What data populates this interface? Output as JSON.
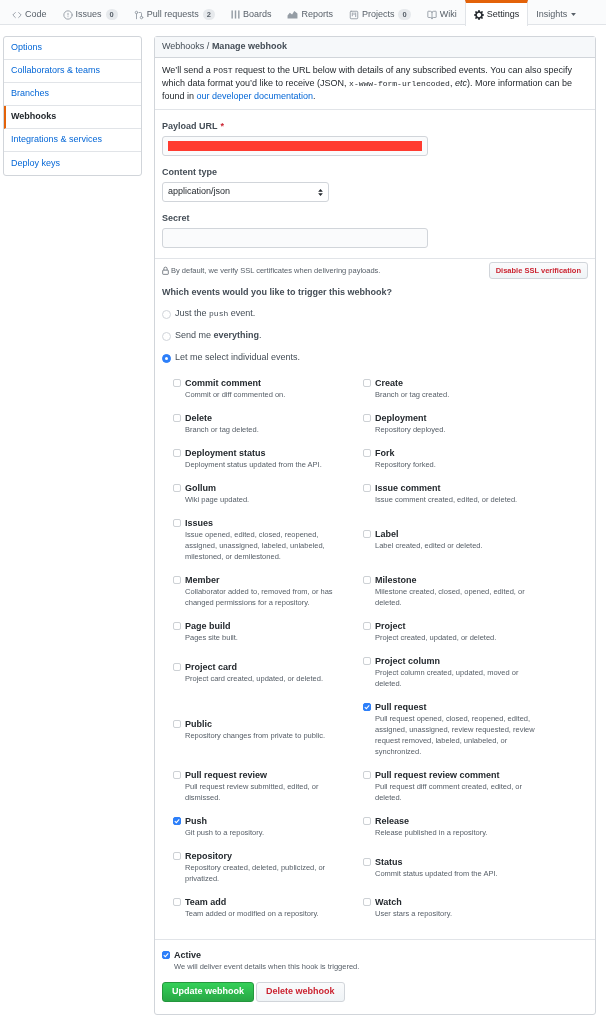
{
  "tabs": [
    {
      "label": "Code",
      "selected": false
    },
    {
      "label": "Issues",
      "count": "0",
      "selected": false
    },
    {
      "label": "Pull requests",
      "count": "2",
      "selected": false
    },
    {
      "label": "Boards",
      "selected": false
    },
    {
      "label": "Reports",
      "selected": false
    },
    {
      "label": "Projects",
      "count": "0",
      "selected": false
    },
    {
      "label": "Wiki",
      "selected": false
    },
    {
      "label": "Settings",
      "selected": true
    },
    {
      "label": "Insights",
      "selected": false,
      "dropdown": true
    }
  ],
  "sidebar": {
    "items": [
      {
        "label": "Options",
        "selected": false
      },
      {
        "label": "Collaborators & teams",
        "selected": false
      },
      {
        "label": "Branches",
        "selected": false
      },
      {
        "label": "Webhooks",
        "selected": true
      },
      {
        "label": "Integrations & services",
        "selected": false
      },
      {
        "label": "Deploy keys",
        "selected": false
      }
    ]
  },
  "panel": {
    "title": "Webhooks / **Manage webhook**",
    "intro": [
      {
        "kind": "text",
        "text": "We’ll send a "
      },
      {
        "kind": "code",
        "text": "POST"
      },
      {
        "kind": "text",
        "text": " request to the URL below with details of any subscribed events. You can also specify which data format you’d like to receive (JSON, "
      },
      {
        "kind": "code",
        "text": "x-www-form-urlencoded"
      },
      {
        "kind": "text",
        "text": ", *etc*). More information can be found in "
      },
      {
        "kind": "link",
        "text": "our developer documentation"
      },
      {
        "kind": "text",
        "text": "."
      }
    ]
  },
  "form": {
    "payload_url": {
      "label": "Payload URL",
      "required_mark": "*",
      "redacted": true
    },
    "content_type": {
      "label": "Content type",
      "value": "application/json"
    },
    "secret": {
      "label": "Secret"
    }
  },
  "ssl": {
    "note": "By default, we verify SSL certificates when delivering payloads.",
    "button": "Disable SSL verification"
  },
  "events": {
    "question": "Which events would you like to trigger this webhook?",
    "options": [
      {
        "parts": [
          {
            "kind": "text",
            "text": "Just the "
          },
          {
            "kind": "code",
            "text": "push"
          },
          {
            "kind": "text",
            "text": " event."
          }
        ],
        "selected": false
      },
      {
        "parts": [
          {
            "kind": "text",
            "text": "Send me **everything**."
          }
        ],
        "selected": false
      },
      {
        "parts": [
          {
            "kind": "text",
            "text": "Let me select individual events."
          }
        ],
        "selected": true
      }
    ],
    "items": [
      {
        "name": "Commit comment",
        "description": "Commit or diff commented on.",
        "checked": false
      },
      {
        "name": "Delete",
        "description": "Branch or tag deleted.",
        "checked": false
      },
      {
        "name": "Deployment status",
        "description": "Deployment status updated from the API.",
        "checked": false
      },
      {
        "name": "Gollum",
        "description": "Wiki page updated.",
        "checked": false
      },
      {
        "name": "Issues",
        "description": "Issue opened, edited, closed, reopened, assigned, unassigned, labeled, unlabeled, milestoned, or demilestoned.",
        "checked": false
      },
      {
        "name": "Member",
        "description": "Collaborator added to, removed from, or has changed permissions for a repository.",
        "checked": false
      },
      {
        "name": "Page build",
        "description": "Pages site built.",
        "checked": false
      },
      {
        "name": "Project card",
        "description": "Project card created, updated, or deleted.",
        "checked": false
      },
      {
        "name": "Public",
        "description": "Repository changes from private to public.",
        "checked": false
      },
      {
        "name": "Pull request review",
        "description": "Pull request review submitted, edited, or dismissed.",
        "checked": false
      },
      {
        "name": "Push",
        "description": "Git push to a repository.",
        "checked": true
      },
      {
        "name": "Repository",
        "description": "Repository created, deleted, publicized, or privatized.",
        "checked": false
      },
      {
        "name": "Team add",
        "description": "Team added or modified on a repository.",
        "checked": false
      },
      {
        "name": "Create",
        "description": "Branch or tag created.",
        "checked": false
      },
      {
        "name": "Deployment",
        "description": "Repository deployed.",
        "checked": false
      },
      {
        "name": "Fork",
        "description": "Repository forked.",
        "checked": false
      },
      {
        "name": "Issue comment",
        "description": "Issue comment created, edited, or deleted.",
        "checked": false
      },
      {
        "name": "Label",
        "description": "Label created, edited or deleted.",
        "checked": false
      },
      {
        "name": "Milestone",
        "description": "Milestone created, closed, opened, edited, or deleted.",
        "checked": false
      },
      {
        "name": "Project",
        "description": "Project created, updated, or deleted.",
        "checked": false
      },
      {
        "name": "Project column",
        "description": "Project column created, updated, moved or deleted.",
        "checked": false
      },
      {
        "name": "Pull request",
        "description": "Pull request opened, closed, reopened, edited, assigned, unassigned, review requested, review request removed, labeled, unlabeled, or synchronized.",
        "checked": true
      },
      {
        "name": "Pull request review comment",
        "description": "Pull request diff comment created, edited, or deleted.",
        "checked": false
      },
      {
        "name": "Release",
        "description": "Release published in a repository.",
        "checked": false
      },
      {
        "name": "Status",
        "description": "Commit status updated from the API.",
        "checked": false
      },
      {
        "name": "Watch",
        "description": "User stars a repository.",
        "checked": false
      }
    ]
  },
  "active": {
    "label": "Active",
    "description": "We will deliver event details when this hook is triggered.",
    "checked": true
  },
  "buttons": [
    {
      "label": "Update webhook",
      "kind": "primary"
    },
    {
      "label": "Delete webhook",
      "kind": "danger"
    }
  ]
}
